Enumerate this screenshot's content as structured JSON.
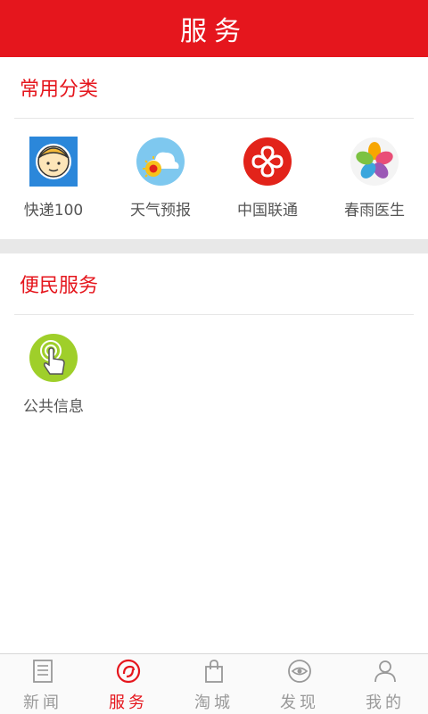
{
  "header": {
    "title": "服务"
  },
  "sections": [
    {
      "title": "常用分类",
      "items": [
        {
          "label": "快递100",
          "icon": "courier-avatar-icon"
        },
        {
          "label": "天气预报",
          "icon": "weather-sun-cloud-icon"
        },
        {
          "label": "中国联通",
          "icon": "china-unicom-logo-icon"
        },
        {
          "label": "春雨医生",
          "icon": "petal-flower-icon"
        }
      ]
    },
    {
      "title": "便民服务",
      "items": [
        {
          "label": "公共信息",
          "icon": "touch-finger-icon"
        }
      ]
    }
  ],
  "bottom_nav": [
    {
      "label": "新闻",
      "icon": "newspaper-icon",
      "active": false
    },
    {
      "label": "服务",
      "icon": "service-icon",
      "active": true
    },
    {
      "label": "淘城",
      "icon": "shopping-bag-icon",
      "active": false
    },
    {
      "label": "发现",
      "icon": "discover-eye-icon",
      "active": false
    },
    {
      "label": "我的",
      "icon": "user-icon",
      "active": false
    }
  ],
  "colors": {
    "brand_red": "#e5161d",
    "text_gray": "#555555",
    "nav_gray": "#999999"
  }
}
